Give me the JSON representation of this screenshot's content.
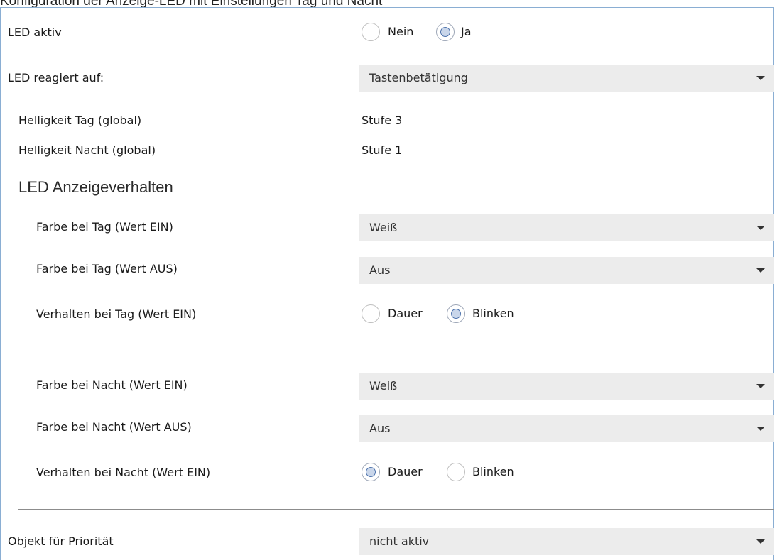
{
  "caption": "Konfiguration der Anzeige-LED mit Einstellungen Tag und Nacht",
  "rows": {
    "led_aktiv": {
      "label": "LED aktiv",
      "opt1": "Nein",
      "opt2": "Ja",
      "selected": "Ja"
    },
    "led_reagiert": {
      "label": "LED reagiert auf:",
      "value": "Tastenbetätigung"
    },
    "hell_tag": {
      "label": "Helligkeit Tag (global)",
      "value": "Stufe 3"
    },
    "hell_nacht": {
      "label": "Helligkeit Nacht (global)",
      "value": "Stufe 1"
    },
    "section_title": "LED Anzeigeverhalten",
    "farbe_tag_ein": {
      "label": "Farbe bei Tag (Wert EIN)",
      "value": "Weiß"
    },
    "farbe_tag_aus": {
      "label": "Farbe bei Tag (Wert AUS)",
      "value": "Aus"
    },
    "verhalten_tag": {
      "label": "Verhalten bei Tag (Wert EIN)",
      "opt1": "Dauer",
      "opt2": "Blinken",
      "selected": "Blinken"
    },
    "farbe_nacht_ein": {
      "label": "Farbe bei Nacht (Wert EIN)",
      "value": "Weiß"
    },
    "farbe_nacht_aus": {
      "label": "Farbe bei Nacht (Wert AUS)",
      "value": "Aus"
    },
    "verhalten_nacht": {
      "label": "Verhalten bei Nacht (Wert EIN)",
      "opt1": "Dauer",
      "opt2": "Blinken",
      "selected": "Dauer"
    },
    "prioritaet": {
      "label": "Objekt für Priorität",
      "value": "nicht aktiv"
    }
  },
  "colors": {
    "border_accent": "#8aaed3",
    "dropdown_bg": "#ececec",
    "radio_dot": "#4c72ac"
  }
}
